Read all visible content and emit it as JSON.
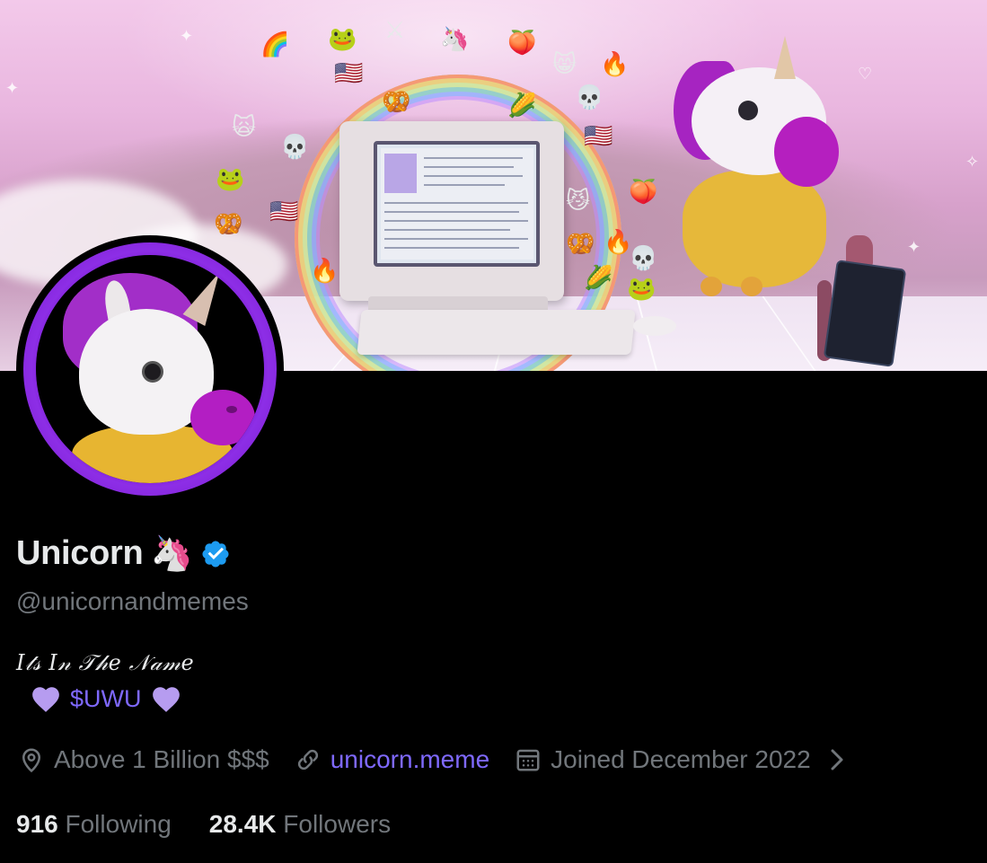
{
  "profile": {
    "display_name": "Unicorn",
    "name_emoji": "🦄",
    "verified": true,
    "handle": "@unicornandmemes",
    "bio": {
      "line1": "𝐼𝓉𝓈 𝐼𝓃 𝒯𝒽𝑒 𝒩𝒶𝓂𝑒",
      "heart_icon": "purple-heart",
      "cashtag": "$UWU"
    },
    "meta": {
      "location_icon": "location-pin-icon",
      "location": "Above 1 Billion $$$",
      "link_icon": "link-icon",
      "website": "unicorn.meme",
      "joined_icon": "calendar-icon",
      "joined": "Joined December 2022"
    },
    "stats": {
      "following_count": "916",
      "following_label": "Following",
      "followers_count": "28.4K",
      "followers_label": "Followers"
    }
  },
  "colors": {
    "background": "#000000",
    "primary_text": "#e7e9ea",
    "secondary_text": "#71767b",
    "link": "#7f69ff",
    "verified_badge": "#1d9bf0",
    "avatar_ring": "#7a1bd2",
    "heart": "#b69cf0"
  }
}
